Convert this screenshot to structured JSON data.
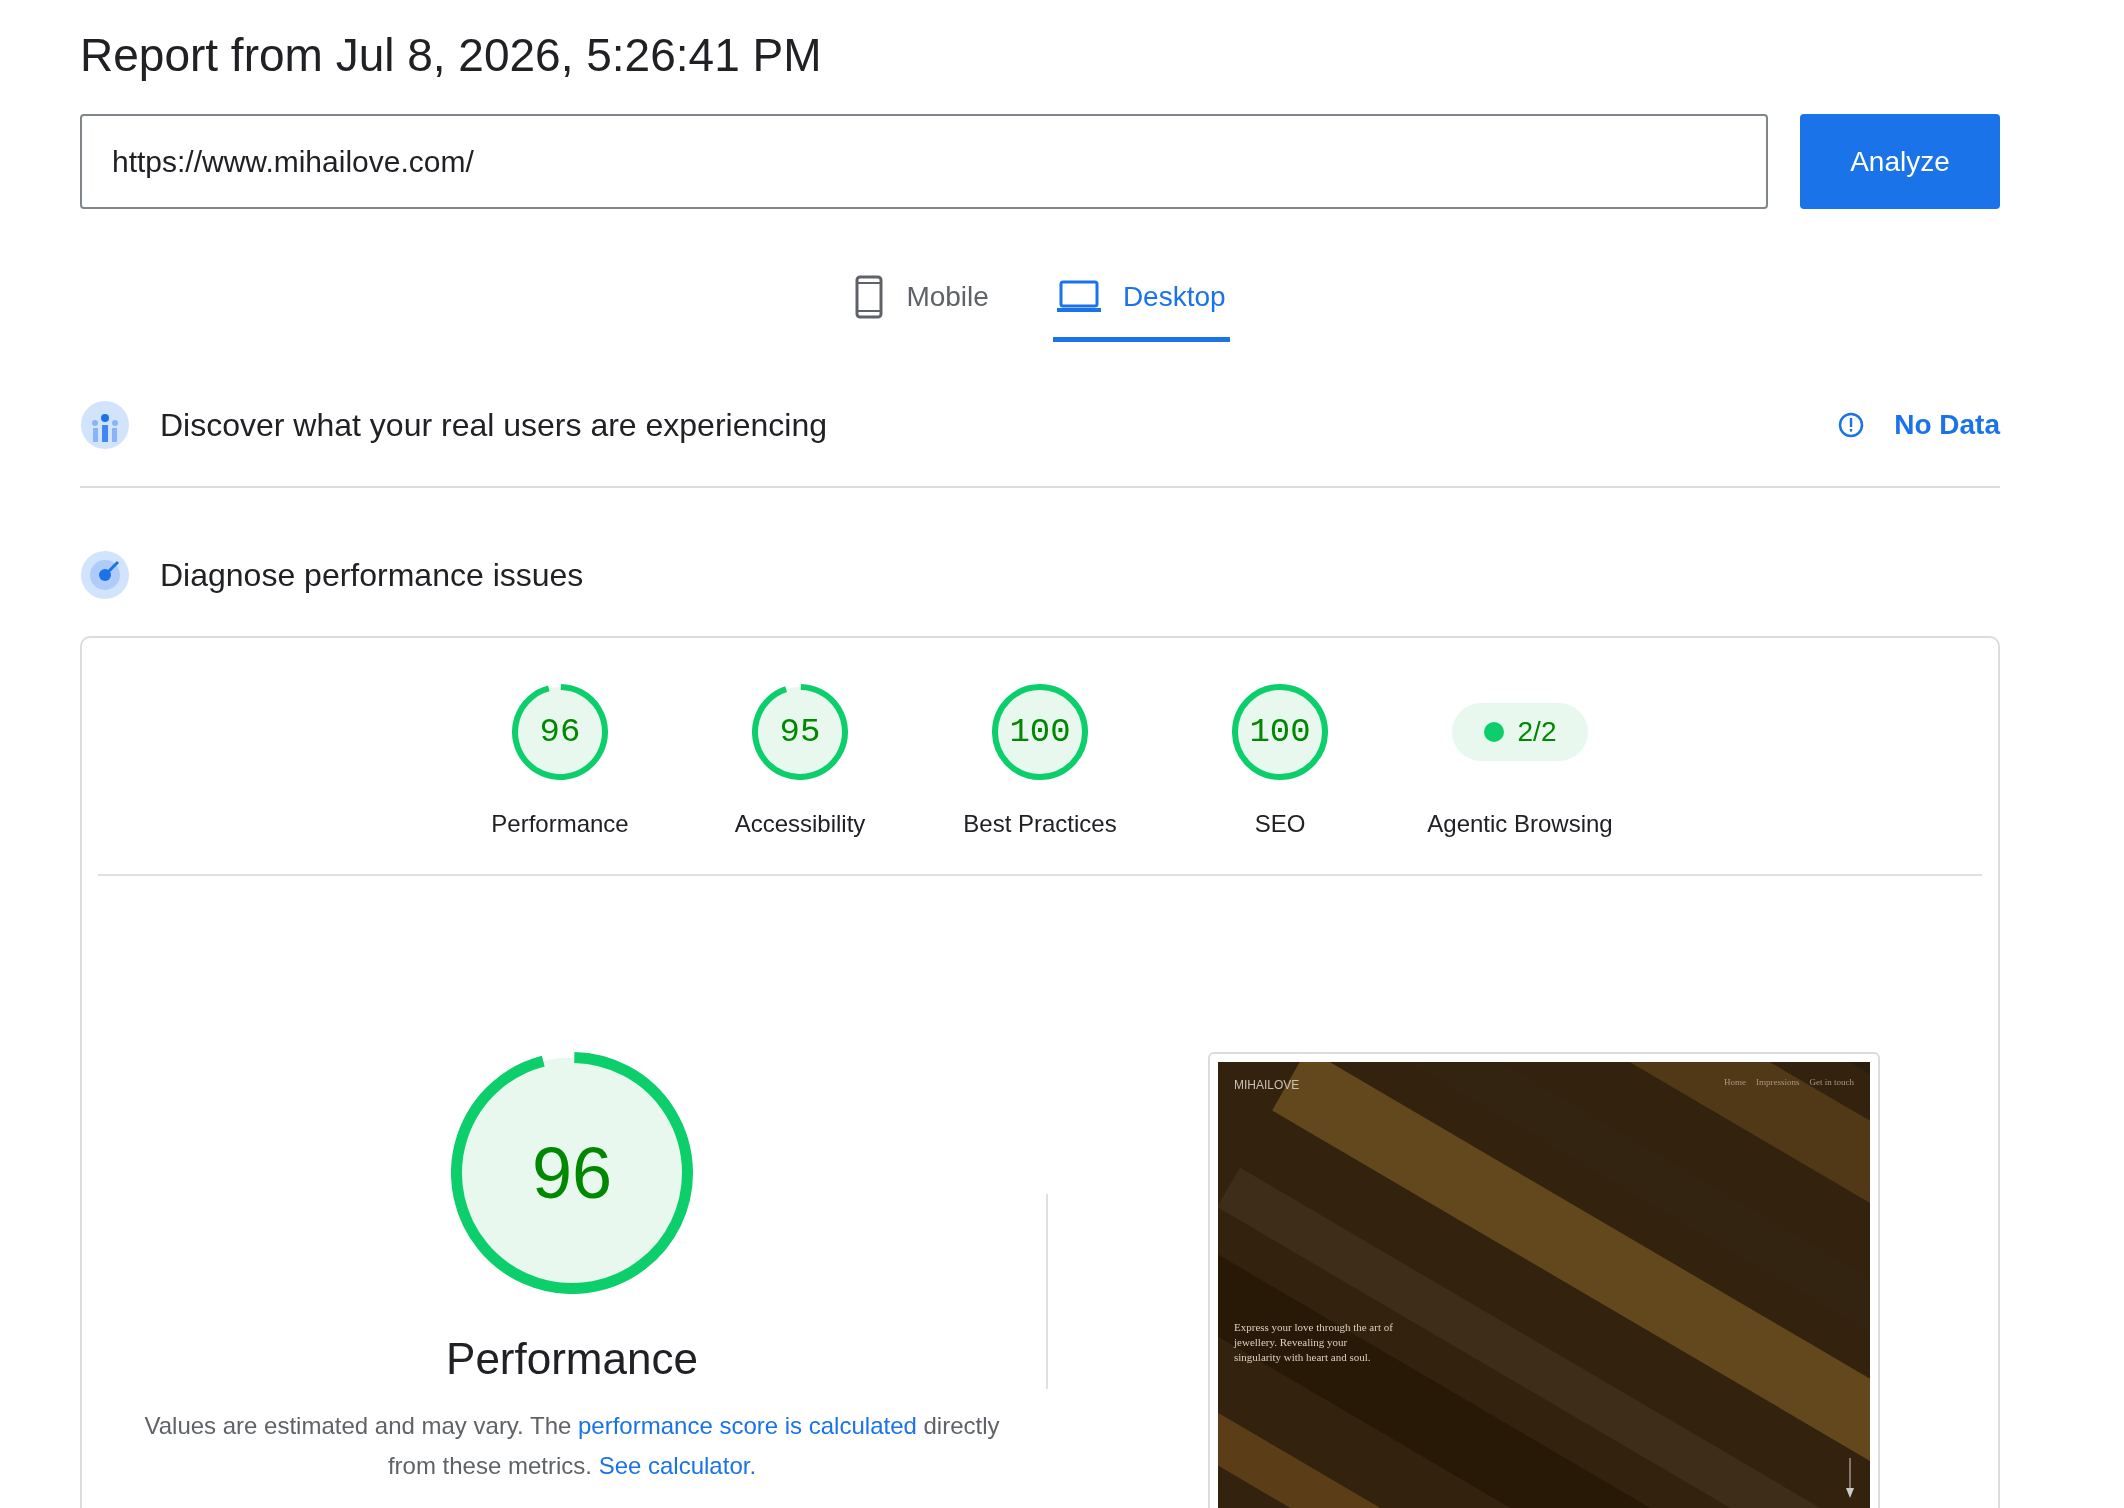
{
  "title": "Report from Jul 8, 2026, 5:26:41 PM",
  "url_field": {
    "value": "https://www.mihailove.com/"
  },
  "analyze_button": "Analyze",
  "tabs": [
    {
      "label": "Mobile",
      "kind": "mobile",
      "selected": false
    },
    {
      "label": "Desktop",
      "kind": "desktop",
      "selected": true
    }
  ],
  "field_data": {
    "heading": "Discover what your real users are experiencing",
    "status": "No Data"
  },
  "diagnose": {
    "heading": "Diagnose performance issues"
  },
  "categories": [
    {
      "kind": "gauge",
      "score": "96",
      "level": 0.96,
      "label": "Performance"
    },
    {
      "kind": "gauge",
      "score": "95",
      "level": 0.95,
      "label": "Accessibility"
    },
    {
      "kind": "gauge",
      "score": "100",
      "level": 1,
      "label": "Best Practices"
    },
    {
      "kind": "gauge",
      "score": "100",
      "level": 1,
      "label": "SEO"
    },
    {
      "kind": "pill",
      "score": "2/2",
      "label": "Agentic Browsing"
    }
  ],
  "performance": {
    "score": "96",
    "level": 0.96,
    "title": "Performance",
    "note": [
      {
        "text": "Values are estimated and may vary. The ",
        "link": false
      },
      {
        "text": "performance score is calculated",
        "link": true
      },
      {
        "text": " directly from these metrics. ",
        "link": false
      },
      {
        "text": "See calculator.",
        "link": true
      }
    ]
  },
  "screenshot": {
    "logo": "MIHAILOVE",
    "nav": [
      "Home",
      "Impressions",
      "Get in touch"
    ],
    "tagline": "Express your love through the art of jewellery. Revealing your singularity with heart and soul."
  }
}
